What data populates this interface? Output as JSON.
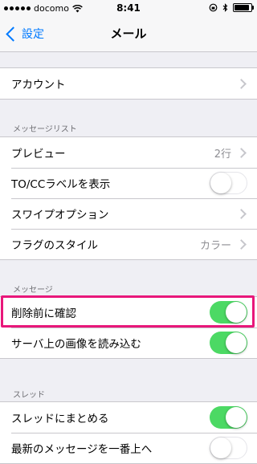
{
  "status_bar": {
    "carrier": "docomo",
    "time": "8:41",
    "battery_level": 0.9
  },
  "nav": {
    "back_label": "設定",
    "title": "メール"
  },
  "sections": {
    "account": {
      "rows": [
        {
          "label": "アカウント"
        }
      ]
    },
    "message_list": {
      "header": "メッセージリスト",
      "rows": [
        {
          "label": "プレビュー",
          "value": "2行"
        },
        {
          "label": "TO/CCラベルを表示",
          "toggle": false
        },
        {
          "label": "スワイプオプション"
        },
        {
          "label": "フラグのスタイル",
          "value": "カラー"
        }
      ]
    },
    "messages": {
      "header": "メッセージ",
      "rows": [
        {
          "label": "削除前に確認",
          "toggle": true
        },
        {
          "label": "サーバ上の画像を読み込む",
          "toggle": true
        }
      ]
    },
    "threads": {
      "header": "スレッド",
      "rows": [
        {
          "label": "スレッドにまとめる",
          "toggle": true
        },
        {
          "label": "最新のメッセージを一番上へ",
          "toggle": false
        }
      ]
    }
  },
  "colors": {
    "accent": "#007aff",
    "toggle_on": "#4cd964",
    "highlight": "#e8177a",
    "background": "#efeff4"
  }
}
